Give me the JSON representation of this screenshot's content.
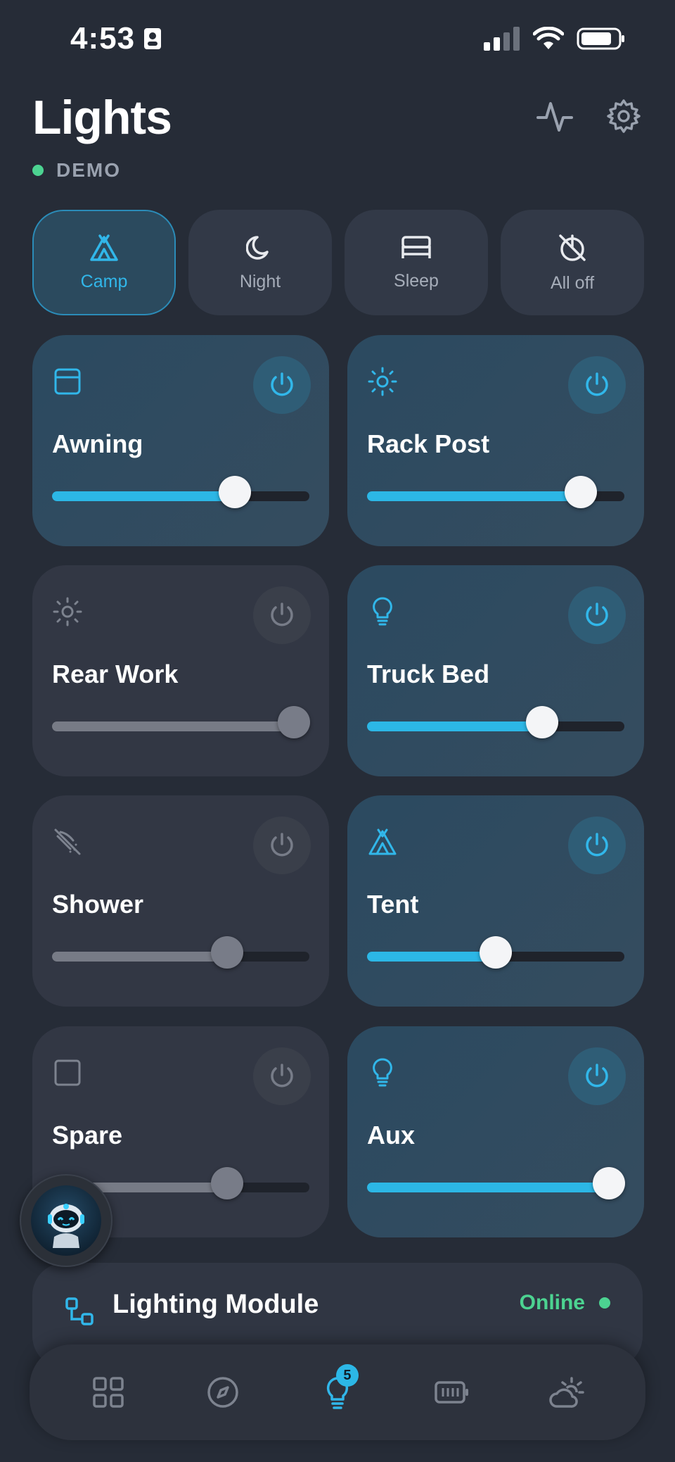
{
  "status_bar": {
    "time": "4:53"
  },
  "header": {
    "title": "Lights",
    "mode": "DEMO"
  },
  "colors": {
    "accent": "#2cb7e6",
    "online": "#4cd391",
    "background": "#262c37"
  },
  "scenes": [
    {
      "label": "Camp",
      "icon": "tent-icon",
      "active": true
    },
    {
      "label": "Night",
      "icon": "moon-icon",
      "active": false
    },
    {
      "label": "Sleep",
      "icon": "bed-icon",
      "active": false
    },
    {
      "label": "All off",
      "icon": "power-off-icon",
      "active": false
    }
  ],
  "lights": [
    {
      "name": "Awning",
      "icon": "awning-icon",
      "on": true,
      "level": 0.71
    },
    {
      "name": "Rack Post",
      "icon": "sun-icon",
      "on": true,
      "level": 0.83
    },
    {
      "name": "Rear Work",
      "icon": "sun-icon",
      "on": false,
      "level": 0.94
    },
    {
      "name": "Truck Bed",
      "icon": "bulb-icon",
      "on": true,
      "level": 0.68
    },
    {
      "name": "Shower",
      "icon": "shower-off-icon",
      "on": false,
      "level": 0.68
    },
    {
      "name": "Tent",
      "icon": "tent-icon",
      "on": true,
      "level": 0.5
    },
    {
      "name": "Spare",
      "icon": "square-icon",
      "on": false,
      "level": 0.68
    },
    {
      "name": "Aux",
      "icon": "bulb-icon",
      "on": true,
      "level": 0.94
    }
  ],
  "module": {
    "label": "Lighting Module",
    "status": "Online"
  },
  "nav": {
    "items": [
      "dashboard-icon",
      "compass-icon",
      "lights-icon",
      "battery-icon",
      "weather-icon"
    ],
    "badge": "5"
  }
}
